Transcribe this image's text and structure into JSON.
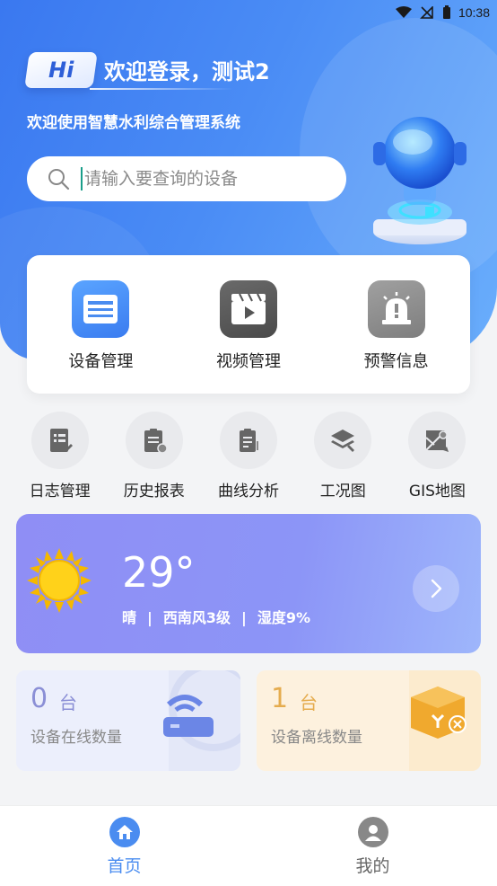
{
  "status_bar": {
    "time": "10:38"
  },
  "header": {
    "badge": "Hi",
    "welcome": "欢迎登录，测试2",
    "subtitle": "欢迎使用智慧水利综合管理系统"
  },
  "search": {
    "placeholder": "请输入要查询的设备"
  },
  "main_actions": [
    {
      "label": "设备管理",
      "icon": "device-list-icon",
      "color": "#4a8cf0"
    },
    {
      "label": "视频管理",
      "icon": "video-icon",
      "color": "#555555"
    },
    {
      "label": "预警信息",
      "icon": "alarm-icon",
      "color": "#8a8a8a"
    }
  ],
  "quick_actions": [
    {
      "label": "日志管理",
      "icon": "log-icon"
    },
    {
      "label": "历史报表",
      "icon": "history-report-icon"
    },
    {
      "label": "曲线分析",
      "icon": "curve-analysis-icon"
    },
    {
      "label": "工况图",
      "icon": "layers-icon"
    },
    {
      "label": "GIS地图",
      "icon": "map-icon"
    }
  ],
  "weather": {
    "temperature": "29°",
    "condition": "晴",
    "wind": "西南风3级",
    "humidity": "湿度9%",
    "separator": "|",
    "icon": "sun-icon"
  },
  "stats": {
    "online": {
      "count": "0",
      "unit": "台",
      "label": "设备在线数量",
      "color": "#8b8fd6"
    },
    "offline": {
      "count": "1",
      "unit": "台",
      "label": "设备离线数量",
      "color": "#e5ac4e"
    }
  },
  "tabbar": {
    "home": {
      "label": "首页",
      "icon": "home-icon"
    },
    "mine": {
      "label": "我的",
      "icon": "user-icon"
    },
    "active_color": "#4a8cf0"
  }
}
